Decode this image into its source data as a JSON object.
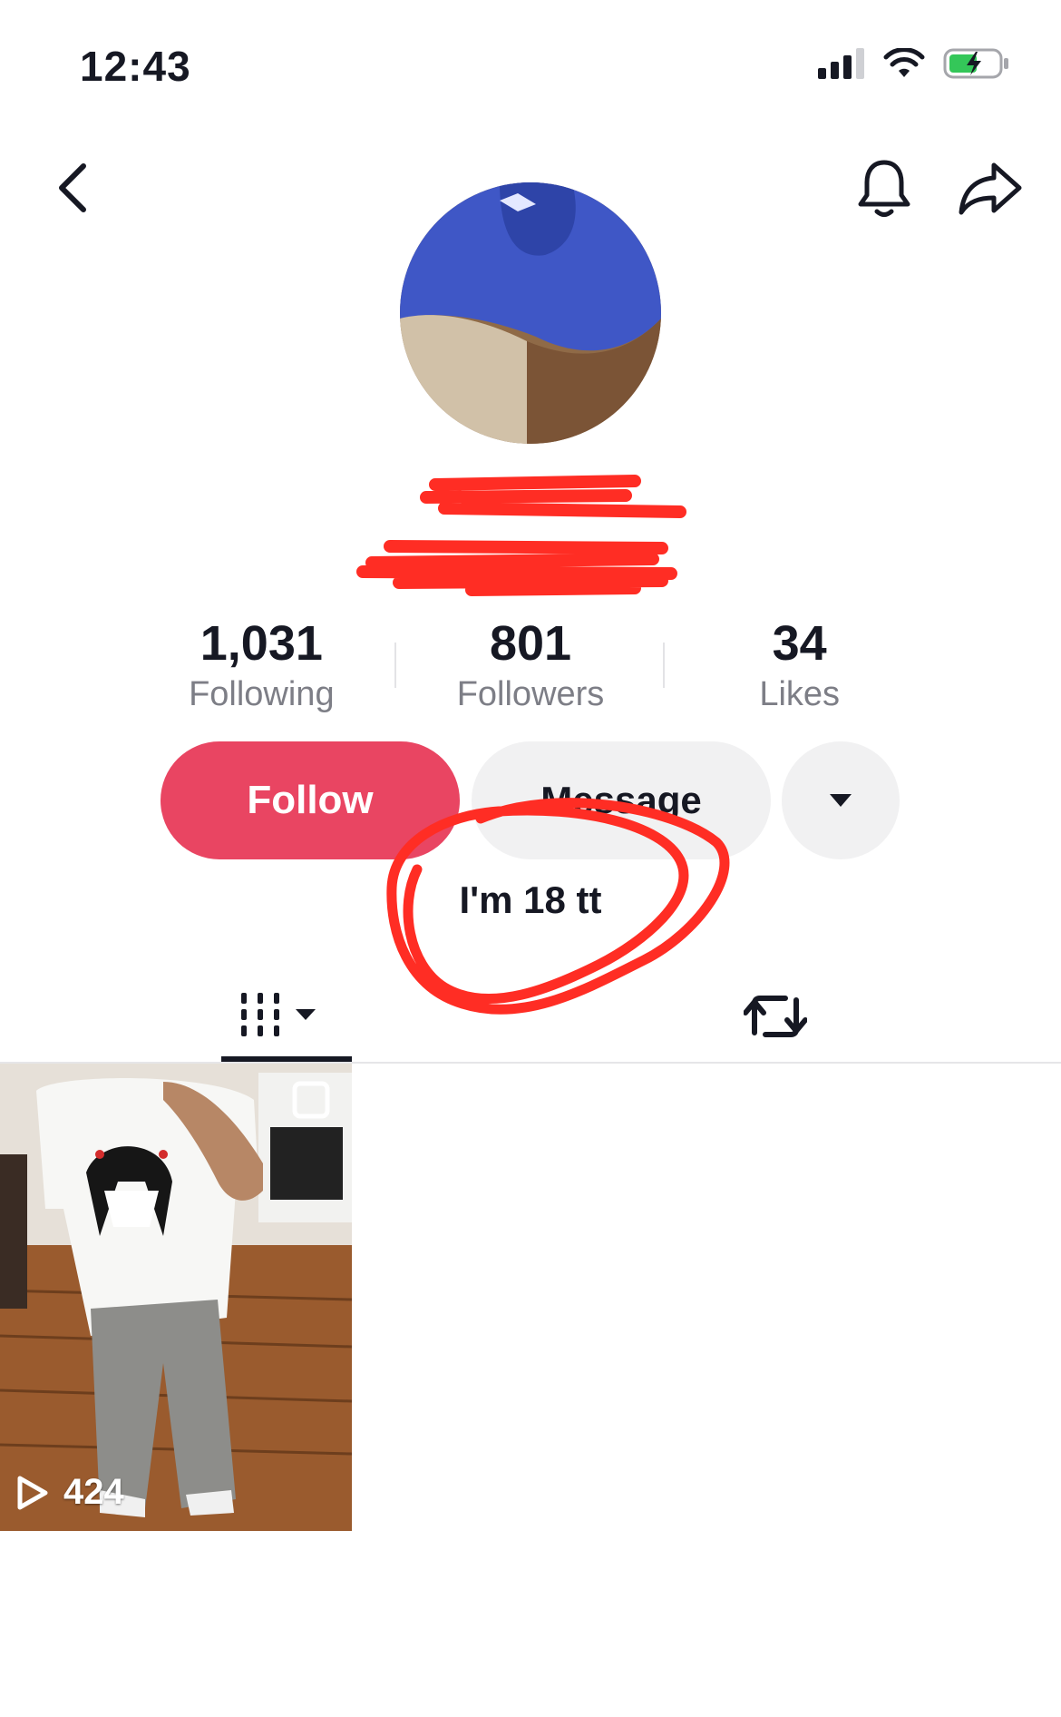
{
  "status_bar": {
    "time": "12:43"
  },
  "profile": {
    "stats": [
      {
        "value": "1,031",
        "label": "Following"
      },
      {
        "value": "801",
        "label": "Followers"
      },
      {
        "value": "34",
        "label": "Likes"
      }
    ],
    "follow_label": "Follow",
    "message_label": "Message",
    "bio": "I'm 18 tt"
  },
  "videos": [
    {
      "play_count": "424"
    }
  ],
  "icons": {
    "back": "chevron-left-icon",
    "bell": "bell-icon",
    "share": "share-arrow-icon",
    "more": "caret-down-icon",
    "videos_tab": "grid-icon",
    "reposts_tab": "repost-icon",
    "play": "play-icon"
  },
  "colors": {
    "follow_button": "#e94562",
    "secondary_button": "#f1f1f2",
    "text_primary": "#161823",
    "text_secondary": "#7d7e86",
    "annotation_red": "#ff2d24"
  }
}
